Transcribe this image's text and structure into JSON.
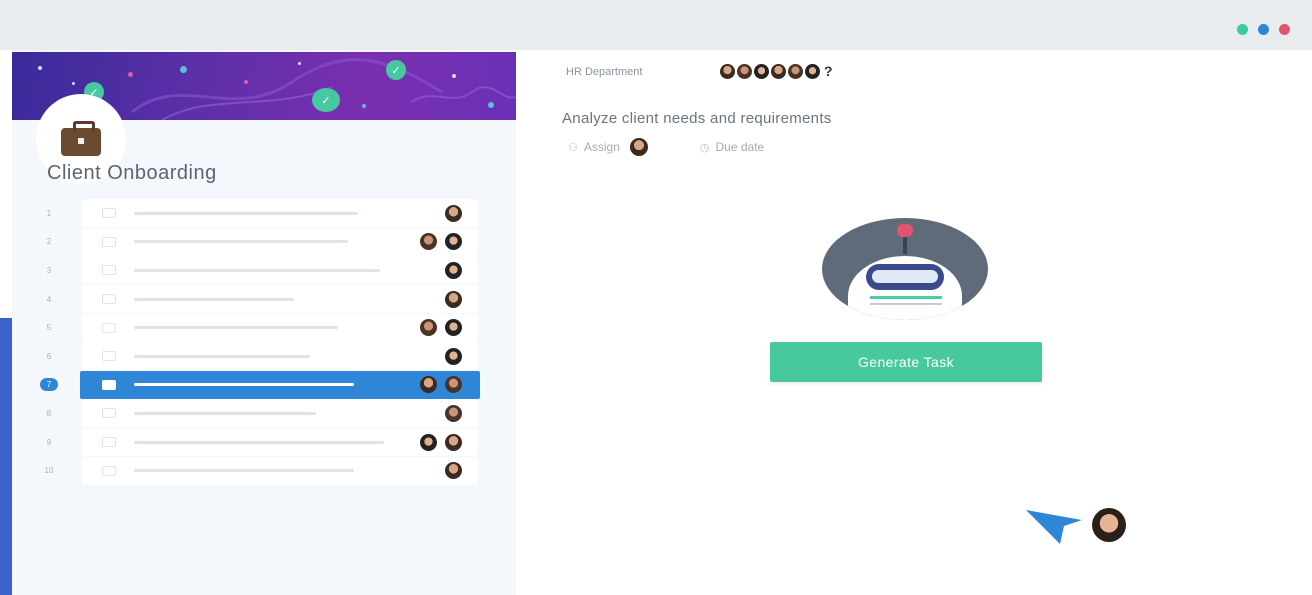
{
  "window": {
    "controls": [
      {
        "name": "minimize",
        "color": "#3cc9a3"
      },
      {
        "name": "maximize",
        "color": "#2f86d6"
      },
      {
        "name": "close",
        "color": "#e0556e"
      }
    ]
  },
  "sidebar": {
    "project_icon": "briefcase-icon",
    "title": "Client Onboarding",
    "tasks": [
      {
        "num": "1",
        "avatars": 1
      },
      {
        "num": "2",
        "avatars": 2
      },
      {
        "num": "3",
        "avatars": 1
      },
      {
        "num": "4",
        "avatars": 1
      },
      {
        "num": "5",
        "avatars": 2
      },
      {
        "num": "6",
        "avatars": 1
      },
      {
        "num": "7",
        "avatars": 2,
        "selected": true
      },
      {
        "num": "8",
        "avatars": 1
      },
      {
        "num": "9",
        "avatars": 2
      },
      {
        "num": "10",
        "avatars": 1
      }
    ]
  },
  "main": {
    "department_label": "HR Department",
    "department_more": "?",
    "task_title": "Analyze client needs and requirements",
    "assign_label": "Assign",
    "due_date_label": "Due date",
    "generate_button": "Generate Task"
  },
  "colors": {
    "accent_blue": "#2f86d6",
    "accent_green": "#47c99d",
    "accent_red": "#e0556e",
    "strip_blue": "#3b62c8"
  }
}
